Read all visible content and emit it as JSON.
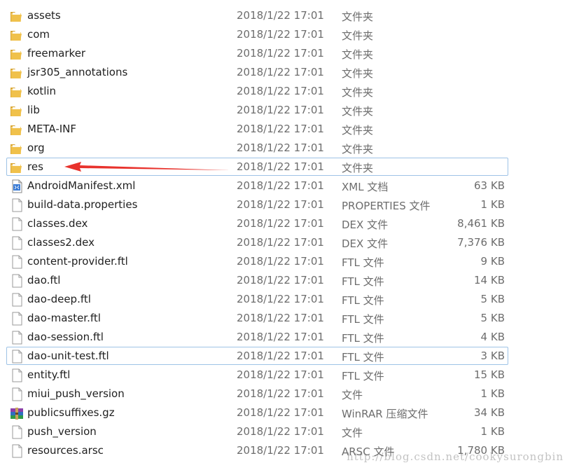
{
  "files": [
    {
      "name": "assets",
      "date": "2018/1/22 17:01",
      "type": "文件夹",
      "size": "",
      "icon": "folder-icon"
    },
    {
      "name": "com",
      "date": "2018/1/22 17:01",
      "type": "文件夹",
      "size": "",
      "icon": "folder-icon"
    },
    {
      "name": "freemarker",
      "date": "2018/1/22 17:01",
      "type": "文件夹",
      "size": "",
      "icon": "folder-icon"
    },
    {
      "name": "jsr305_annotations",
      "date": "2018/1/22 17:01",
      "type": "文件夹",
      "size": "",
      "icon": "folder-icon"
    },
    {
      "name": "kotlin",
      "date": "2018/1/22 17:01",
      "type": "文件夹",
      "size": "",
      "icon": "folder-icon"
    },
    {
      "name": "lib",
      "date": "2018/1/22 17:01",
      "type": "文件夹",
      "size": "",
      "icon": "folder-icon"
    },
    {
      "name": "META-INF",
      "date": "2018/1/22 17:01",
      "type": "文件夹",
      "size": "",
      "icon": "folder-icon"
    },
    {
      "name": "org",
      "date": "2018/1/22 17:01",
      "type": "文件夹",
      "size": "",
      "icon": "folder-icon"
    },
    {
      "name": "res",
      "date": "2018/1/22 17:01",
      "type": "文件夹",
      "size": "",
      "icon": "folder-icon",
      "selected": true
    },
    {
      "name": "AndroidManifest.xml",
      "date": "2018/1/22 17:01",
      "type": "XML 文档",
      "size": "63 KB",
      "icon": "xml-file-icon"
    },
    {
      "name": "build-data.properties",
      "date": "2018/1/22 17:01",
      "type": "PROPERTIES 文件",
      "size": "1 KB",
      "icon": "file-icon"
    },
    {
      "name": "classes.dex",
      "date": "2018/1/22 17:01",
      "type": "DEX 文件",
      "size": "8,461 KB",
      "icon": "file-icon"
    },
    {
      "name": "classes2.dex",
      "date": "2018/1/22 17:01",
      "type": "DEX 文件",
      "size": "7,376 KB",
      "icon": "file-icon"
    },
    {
      "name": "content-provider.ftl",
      "date": "2018/1/22 17:01",
      "type": "FTL 文件",
      "size": "9 KB",
      "icon": "file-icon"
    },
    {
      "name": "dao.ftl",
      "date": "2018/1/22 17:01",
      "type": "FTL 文件",
      "size": "14 KB",
      "icon": "file-icon"
    },
    {
      "name": "dao-deep.ftl",
      "date": "2018/1/22 17:01",
      "type": "FTL 文件",
      "size": "5 KB",
      "icon": "file-icon"
    },
    {
      "name": "dao-master.ftl",
      "date": "2018/1/22 17:01",
      "type": "FTL 文件",
      "size": "5 KB",
      "icon": "file-icon"
    },
    {
      "name": "dao-session.ftl",
      "date": "2018/1/22 17:01",
      "type": "FTL 文件",
      "size": "4 KB",
      "icon": "file-icon"
    },
    {
      "name": "dao-unit-test.ftl",
      "date": "2018/1/22 17:01",
      "type": "FTL 文件",
      "size": "3 KB",
      "icon": "file-icon",
      "selected": true
    },
    {
      "name": "entity.ftl",
      "date": "2018/1/22 17:01",
      "type": "FTL 文件",
      "size": "15 KB",
      "icon": "file-icon"
    },
    {
      "name": "miui_push_version",
      "date": "2018/1/22 17:01",
      "type": "文件",
      "size": "1 KB",
      "icon": "file-icon"
    },
    {
      "name": "publicsuffixes.gz",
      "date": "2018/1/22 17:01",
      "type": "WinRAR 压缩文件",
      "size": "34 KB",
      "icon": "winrar-archive-icon"
    },
    {
      "name": "push_version",
      "date": "2018/1/22 17:01",
      "type": "文件",
      "size": "1 KB",
      "icon": "file-icon"
    },
    {
      "name": "resources.arsc",
      "date": "2018/1/22 17:01",
      "type": "ARSC 文件",
      "size": "1,780 KB",
      "icon": "file-icon"
    }
  ],
  "annotation": {
    "arrow_color": "#e8322c",
    "points_to": "res"
  },
  "watermark": "http://blog.csdn.net/cookysurongbin"
}
